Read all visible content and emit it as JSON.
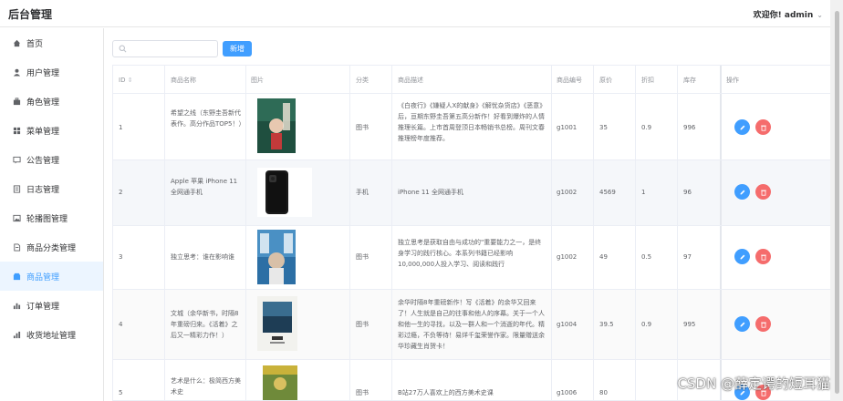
{
  "header": {
    "title": "后台管理",
    "greeting": "欢迎你! admin"
  },
  "sidebar": {
    "items": [
      {
        "label": "首页",
        "icon": "home-icon"
      },
      {
        "label": "用户管理",
        "icon": "user-icon"
      },
      {
        "label": "角色管理",
        "icon": "briefcase-icon"
      },
      {
        "label": "菜单管理",
        "icon": "menu-icon"
      },
      {
        "label": "公告管理",
        "icon": "notice-icon"
      },
      {
        "label": "日志管理",
        "icon": "log-icon"
      },
      {
        "label": "轮播图管理",
        "icon": "picture-icon"
      },
      {
        "label": "商品分类管理",
        "icon": "category-icon"
      },
      {
        "label": "商品管理",
        "icon": "goods-icon",
        "active": true
      },
      {
        "label": "订单管理",
        "icon": "chart-icon"
      },
      {
        "label": "收货地址管理",
        "icon": "address-icon"
      }
    ]
  },
  "toolbar": {
    "search_placeholder": "",
    "new_label": "新增"
  },
  "table": {
    "headers": [
      "ID",
      "商品名称",
      "图片",
      "分类",
      "商品描述",
      "商品编号",
      "原价",
      "折扣",
      "库存",
      "操作"
    ],
    "rows": [
      {
        "id": "1",
        "name": "希望之线（东野圭吾新代表作。高分作品TOP5！）",
        "category": "图书",
        "desc": "《白夜行》《嫌疑人X的献身》《解忧杂货店》《恶意》后，亘期东野圭吾第五高分新作！好看到爆炸的人情推理长篇。上市首周登顶日本畅销书总榜。周刊文春推理榜年度推荐。",
        "code": "g1001",
        "price": "35",
        "discount": "0.9",
        "stock": "996"
      },
      {
        "id": "2",
        "name": "Apple 苹果 iPhone 11 全网通手机",
        "category": "手机",
        "desc": "iPhone 11 全网通手机",
        "code": "g1002",
        "price": "4569",
        "discount": "1",
        "stock": "96"
      },
      {
        "id": "3",
        "name": "独立思考：谁在影响谁",
        "category": "图书",
        "desc": "独立思考是获取自由与成功的\"重要能力之一，是终身学习的践行核心。本系列书籍已经影响10,000,000人投入学习、阅读和践行",
        "code": "g1002",
        "price": "49",
        "discount": "0.5",
        "stock": "97"
      },
      {
        "id": "4",
        "name": "文城（余华新书，时隔8年重磅归来。《活着》之后又一精彩力作！）",
        "category": "图书",
        "desc": "余华时隔8年重磅新作！写《活着》的余华又回来了！人生就是自己的往事和他人的序幕。关于一个人和他一生的寻找，以及一群人和一个消逝的年代。精彩过瘾，不负等待！易烊千玺荣誉作家。限量赠送余华珍藏生肖贺卡！",
        "code": "g1004",
        "price": "39.5",
        "discount": "0.9",
        "stock": "995"
      },
      {
        "id": "5",
        "name": "艺术是什么：极简西方美术史",
        "category": "图书",
        "desc": "B站27万人喜欢上的西方美术史课",
        "code": "g1006",
        "price": "80",
        "discount": "",
        "stock": ""
      }
    ]
  },
  "watermark": "CSDN @薛定谔的短耳猫",
  "colors": {
    "primary": "#409eff",
    "danger": "#f56c6c",
    "active_bg": "#ecf5ff"
  }
}
